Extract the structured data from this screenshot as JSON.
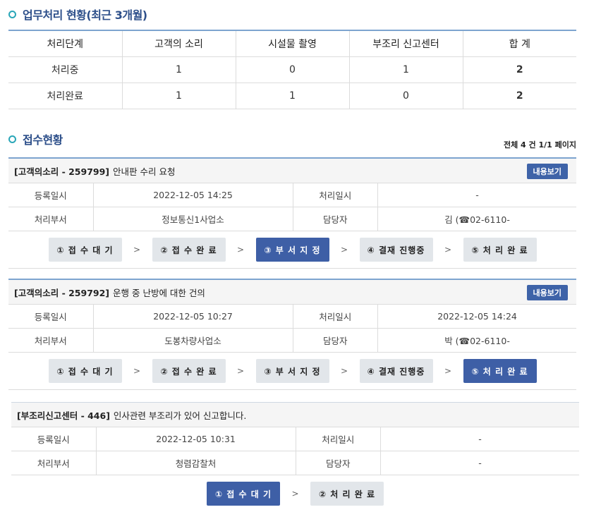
{
  "section1": {
    "title": "업무처리 현황(최근 3개월)"
  },
  "summary": {
    "headers": [
      "처리단계",
      "고객의 소리",
      "시설물 촬영",
      "부조리 신고센터",
      "합 계"
    ],
    "rows": [
      [
        "처리중",
        "1",
        "0",
        "1",
        "2"
      ],
      [
        "처리완료",
        "1",
        "1",
        "0",
        "2"
      ]
    ]
  },
  "section2": {
    "title": "접수현황",
    "meta": "전체 4 건 1/1 페이지"
  },
  "labels": {
    "reg_date": "등록일시",
    "proc_date": "처리일시",
    "dept": "처리부서",
    "manager": "담당자",
    "view": "내용보기",
    "sep": ">"
  },
  "cards": [
    {
      "tag": "[고객의소리 - 259799]",
      "subject": "안내판 수리 요청",
      "reg_date": "2022-12-05 14:25",
      "proc_date": "-",
      "dept": "정보통신1사업소",
      "manager": "김       (☎02-6110-",
      "steps": [
        "① 접 수 대 기",
        "② 접 수 완 료",
        "③ 부 서 지 정",
        "④ 결재 진행중",
        "⑤ 처 리 완 료"
      ],
      "active_step": 2
    },
    {
      "tag": "[고객의소리 - 259792]",
      "subject": "운행 중 난방에 대한 건의",
      "reg_date": "2022-12-05 10:27",
      "proc_date": "2022-12-05 14:24",
      "dept": "도봉차량사업소",
      "manager": "박       (☎02-6110-",
      "steps": [
        "① 접 수 대 기",
        "② 접 수 완 료",
        "③ 부 서 지 정",
        "④ 결재 진행중",
        "⑤ 처 리 완 료"
      ],
      "active_step": 4
    },
    {
      "tag": "[부조리신고센터 - 446]",
      "subject": "인사관련 부조리가 있어 신고합니다.",
      "reg_date": "2022-12-05 10:31",
      "proc_date": "-",
      "dept": "청렴감찰처",
      "manager": "-",
      "steps": [
        "① 접 수 대 기",
        "② 처 리 완 료"
      ],
      "active_step": 0
    }
  ]
}
